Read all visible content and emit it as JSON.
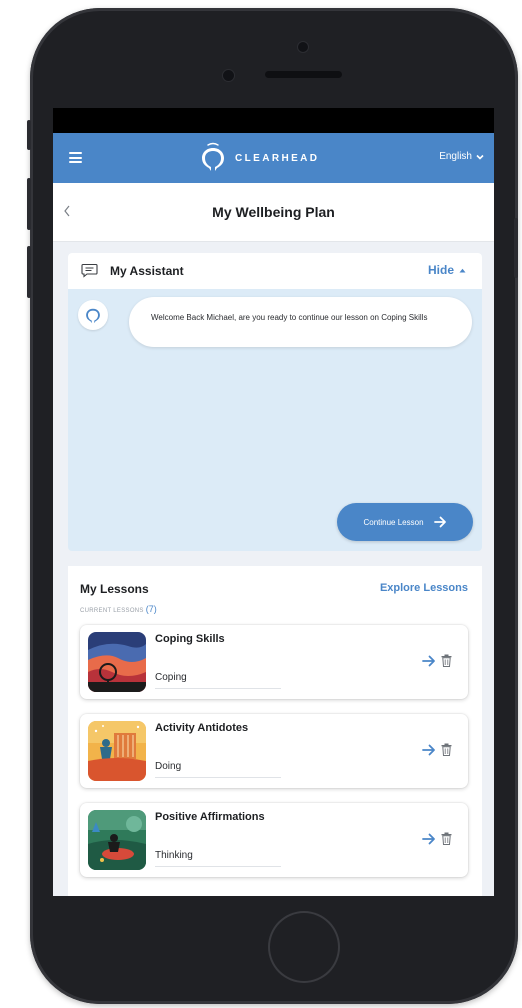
{
  "app": {
    "brand": "CLEARHEAD",
    "language": "English",
    "colors": {
      "primary": "#4a86c8",
      "assistant_bg": "#dcebf7",
      "frame": "#1f2024"
    }
  },
  "page": {
    "title": "My Wellbeing Plan"
  },
  "assistant": {
    "title": "My Assistant",
    "hide_label": "Hide",
    "message": "Welcome Back Michael, are you ready to continue our lesson on Coping Skills",
    "continue_label": "Continue Lesson"
  },
  "lessons": {
    "title": "My Lessons",
    "explore_label": "Explore Lessons",
    "current_label": "CURRENT LESSONS",
    "current_count": "(7)",
    "items": [
      {
        "title": "Coping Skills",
        "category": "Coping"
      },
      {
        "title": "Activity Antidotes",
        "category": "Doing"
      },
      {
        "title": "Positive Affirmations",
        "category": "Thinking"
      }
    ]
  },
  "icons": {
    "menu": "hamburger-icon",
    "back": "chevron-left-icon",
    "language": "chevron-down-icon",
    "assistant": "chat-bubble-icon",
    "hide": "caret-up-icon",
    "continue": "arrow-right-icon",
    "lesson_open": "arrow-right-icon",
    "lesson_delete": "trash-icon"
  }
}
